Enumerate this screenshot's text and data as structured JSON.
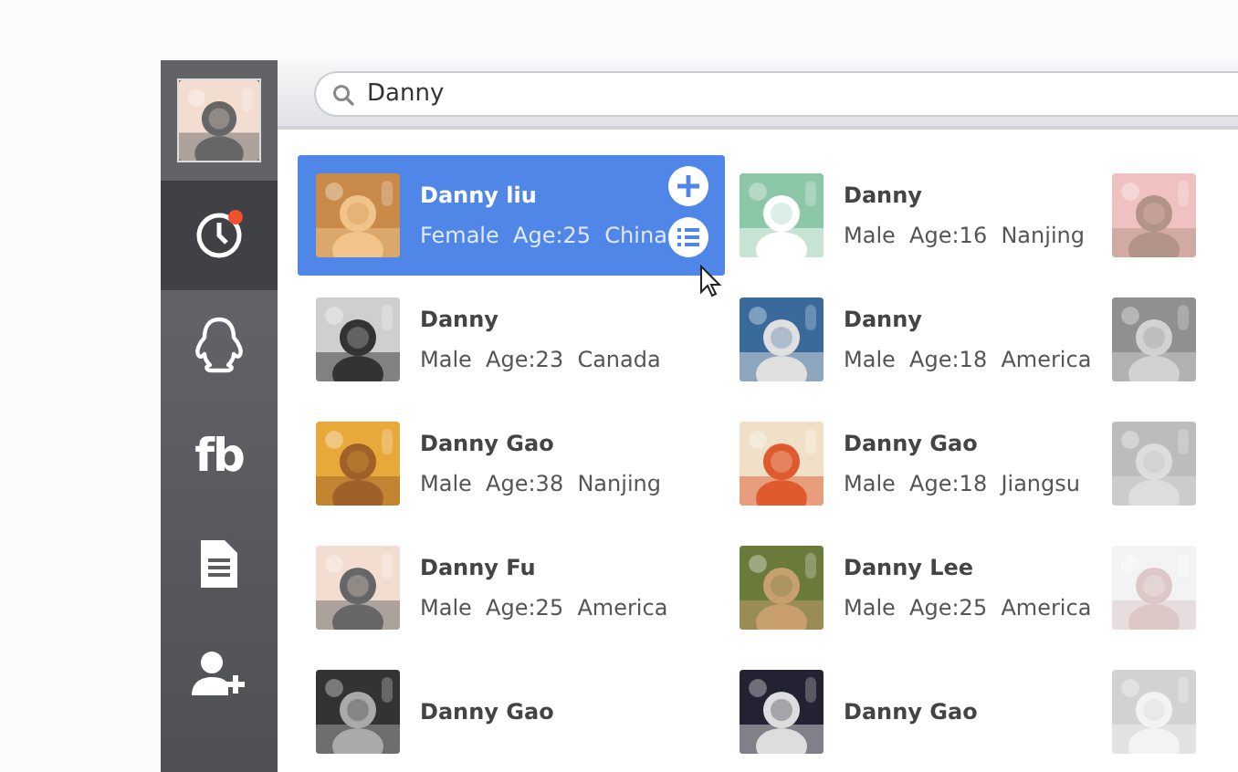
{
  "sidebar": {
    "items": [
      {
        "kind": "profile"
      },
      {
        "kind": "clock",
        "selected": true,
        "badge": true
      },
      {
        "kind": "penguin",
        "selected": false,
        "badge": false
      },
      {
        "kind": "text",
        "label": "fb",
        "selected": false,
        "badge": false
      },
      {
        "kind": "document",
        "selected": false,
        "badge": false
      },
      {
        "kind": "add-user",
        "selected": false,
        "badge": false
      }
    ]
  },
  "search": {
    "value": "Danny"
  },
  "contacts": [
    {
      "name": "Danny liu",
      "details": "Female  Age:25  China",
      "selected": true
    },
    {
      "name": "Danny",
      "details": "Male  Age:16  Nanjing",
      "selected": false
    },
    {
      "kind": "picture"
    },
    {
      "name": "Danny",
      "details": "Male  Age:23  Canada",
      "selected": false
    },
    {
      "name": "Danny",
      "details": "Male  Age:18  America",
      "selected": false
    },
    {
      "kind": "picture"
    },
    {
      "name": "Danny Gao",
      "details": "Male  Age:38  Nanjing",
      "selected": false
    },
    {
      "name": "Danny Gao",
      "details": "Male  Age:18  Jiangsu",
      "selected": false
    },
    {
      "kind": "picture"
    },
    {
      "name": "Danny Fu",
      "details": "Male  Age:25  America",
      "selected": false
    },
    {
      "name": "Danny Lee",
      "details": "Male  Age:25  America",
      "selected": false
    },
    {
      "kind": "picture"
    },
    {
      "name": "Danny Gao",
      "selected": false
    },
    {
      "name": "Danny Gao",
      "selected": false
    },
    {
      "kind": "picture"
    }
  ]
}
